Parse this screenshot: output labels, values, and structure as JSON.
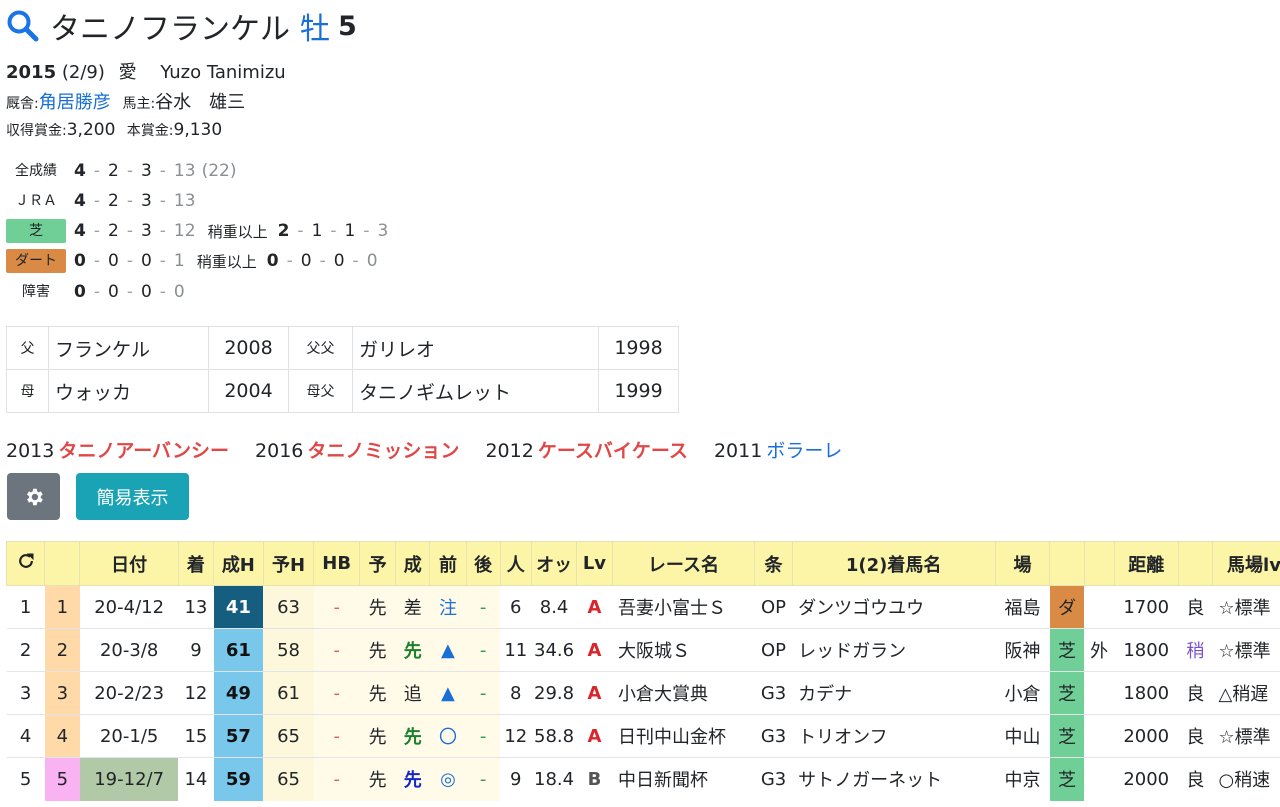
{
  "horse": {
    "name": "タニノフランケル",
    "sex": "牡",
    "age": "5",
    "birth_year": "2015",
    "birth_date": "(2/9)",
    "country": "愛",
    "breeder": "Yuzo Tanimizu",
    "stable_label": "厩舎:",
    "trainer": "角居勝彦",
    "owner_label": "馬主:",
    "owner": "谷水　雄三",
    "earned_label": "収得賞金:",
    "earned": "3,200",
    "prize_label": "本賞金:",
    "prize": "9,130"
  },
  "records": {
    "all": {
      "label": "全成績",
      "w": "4",
      "s": "2",
      "t": "3",
      "o": "13",
      "total": "(22)"
    },
    "jra": {
      "label": "ＪＲＡ",
      "w": "4",
      "s": "2",
      "t": "3",
      "o": "13"
    },
    "turf": {
      "label": "芝",
      "w": "4",
      "s": "2",
      "t": "3",
      "o": "12",
      "heavy_label": "稍重以上",
      "hw": "2",
      "hs": "1",
      "ht": "1",
      "ho": "3"
    },
    "dirt": {
      "label": "ダート",
      "w": "0",
      "s": "0",
      "t": "0",
      "o": "1",
      "heavy_label": "稍重以上",
      "hw": "0",
      "hs": "0",
      "ht": "0",
      "ho": "0"
    },
    "jump": {
      "label": "障害",
      "w": "0",
      "s": "0",
      "t": "0",
      "o": "0"
    }
  },
  "pedigree": {
    "sire_label": "父",
    "sire": "フランケル",
    "sire_year": "2008",
    "sire_sire_label": "父父",
    "sire_sire": "ガリレオ",
    "sire_sire_year": "1998",
    "dam_label": "母",
    "dam": "ウォッカ",
    "dam_year": "2004",
    "dam_sire_label": "母父",
    "dam_sire": "タニノギムレット",
    "dam_sire_year": "1999"
  },
  "siblings": [
    {
      "year": "2013",
      "name": "タニノアーバンシー"
    },
    {
      "year": "2016",
      "name": "タニノミッション"
    },
    {
      "year": "2012",
      "name": "ケースバイケース"
    },
    {
      "year": "2011",
      "name": "ボラーレ"
    }
  ],
  "buttons": {
    "simple": "簡易表示"
  },
  "table": {
    "headers": {
      "date": "日付",
      "finish": "着",
      "seiH": "成H",
      "yoH": "予H",
      "hb": "HB",
      "yo": "予",
      "sei": "成",
      "mae": "前",
      "ato": "後",
      "ninki": "人",
      "odds": "オッ",
      "lv": "Lv",
      "race": "レース名",
      "jo": "条",
      "winner": "1(2)着馬名",
      "place": "場",
      "dist": "距離",
      "going": "馬場lv"
    },
    "rows": [
      {
        "n": "1",
        "idx": "1",
        "date": "20-4/12",
        "finish": "13",
        "seiH": "41",
        "yoH": "63",
        "hb": "-",
        "yo": "先",
        "sei": "差",
        "mae": "注",
        "ato": "-",
        "ninki": "6",
        "odds": "8.4",
        "lv": "A",
        "race": "吾妻小富士Ｓ",
        "jo": "OP",
        "winner": "ダンツゴウユウ",
        "place": "福島",
        "surface": "ダ",
        "course": "",
        "dist": "1700",
        "cond": "良",
        "going": "☆標準"
      },
      {
        "n": "2",
        "idx": "2",
        "date": "20-3/8",
        "finish": "9",
        "seiH": "61",
        "yoH": "58",
        "hb": "-",
        "yo": "先",
        "sei": "先",
        "mae": "▲",
        "ato": "-",
        "ninki": "11",
        "odds": "34.6",
        "lv": "A",
        "race": "大阪城Ｓ",
        "jo": "OP",
        "winner": "レッドガラン",
        "place": "阪神",
        "surface": "芝",
        "course": "外",
        "dist": "1800",
        "cond": "稍",
        "going": "☆標準"
      },
      {
        "n": "3",
        "idx": "3",
        "date": "20-2/23",
        "finish": "12",
        "seiH": "49",
        "yoH": "61",
        "hb": "-",
        "yo": "先",
        "sei": "追",
        "mae": "▲",
        "ato": "-",
        "ninki": "8",
        "odds": "29.8",
        "lv": "A",
        "race": "小倉大賞典",
        "jo": "G3",
        "winner": "カデナ",
        "place": "小倉",
        "surface": "芝",
        "course": "",
        "dist": "1800",
        "cond": "良",
        "going": "△稍遅"
      },
      {
        "n": "4",
        "idx": "4",
        "date": "20-1/5",
        "finish": "15",
        "seiH": "57",
        "yoH": "65",
        "hb": "-",
        "yo": "先",
        "sei": "先",
        "mae": "〇",
        "ato": "-",
        "ninki": "12",
        "odds": "58.8",
        "lv": "A",
        "race": "日刊中山金杯",
        "jo": "G3",
        "winner": "トリオンフ",
        "place": "中山",
        "surface": "芝",
        "course": "",
        "dist": "2000",
        "cond": "良",
        "going": "☆標準"
      },
      {
        "n": "5",
        "idx": "5",
        "date": "19-12/7",
        "finish": "14",
        "seiH": "59",
        "yoH": "65",
        "hb": "-",
        "yo": "先",
        "sei": "先",
        "mae": "◎",
        "ato": "-",
        "ninki": "9",
        "odds": "18.4",
        "lv": "B",
        "race": "中日新聞杯",
        "jo": "G3",
        "winner": "サトノガーネット",
        "place": "中京",
        "surface": "芝",
        "course": "",
        "dist": "2000",
        "cond": "良",
        "going": "○稍速"
      }
    ]
  }
}
